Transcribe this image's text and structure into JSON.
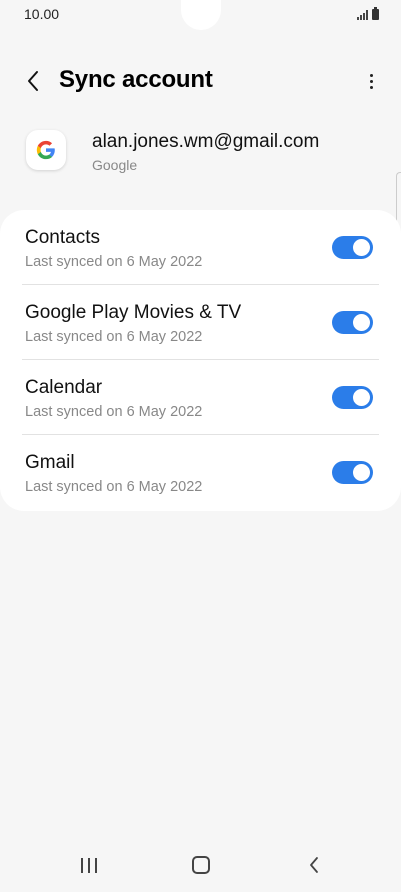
{
  "status_bar": {
    "time": "10.00",
    "icons": [
      "signal-icon",
      "battery-icon"
    ]
  },
  "header": {
    "title": "Sync account",
    "back_icon": "chevron-left-icon",
    "more_icon": "more-vertical-icon"
  },
  "account": {
    "email": "alan.jones.wm@gmail.com",
    "provider": "Google",
    "logo_icon": "google-logo-icon"
  },
  "sync_items": [
    {
      "name": "Contacts",
      "status": "Last synced on 6 May 2022",
      "enabled": true
    },
    {
      "name": "Google Play Movies & TV",
      "status": "Last synced on 6 May 2022",
      "enabled": true
    },
    {
      "name": "Calendar",
      "status": "Last synced on 6 May 2022",
      "enabled": true
    },
    {
      "name": "Gmail",
      "status": "Last synced on 6 May 2022",
      "enabled": true
    }
  ],
  "nav_bar": {
    "icons": [
      "recents-icon",
      "home-icon",
      "back-icon"
    ]
  },
  "colors": {
    "toggle_on": "#2b7de9",
    "background": "#f6f6f6",
    "card": "#ffffff"
  }
}
